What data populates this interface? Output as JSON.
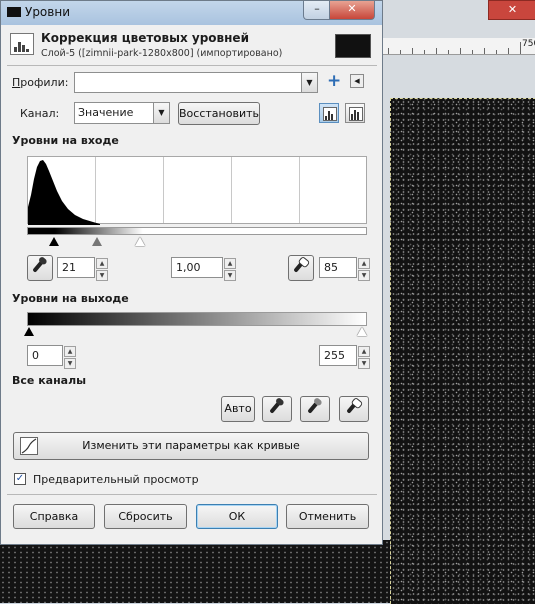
{
  "window": {
    "title": "Уровни",
    "close_glyph": "✕",
    "minimize_glyph": "–"
  },
  "header": {
    "title": "Коррекция цветовых уровней",
    "subtitle": "Слой-5 ([zimnii-park-1280x800] (импортировано)"
  },
  "profiles": {
    "label": "Профили:",
    "value": "",
    "add_icon": "plus-icon",
    "menu_icon": "triangle-left-icon"
  },
  "channel": {
    "label": "Канал:",
    "selected": "Значение",
    "reset_label": "Восстановить",
    "linear_mode": "active",
    "log_mode": "inactive"
  },
  "input_levels": {
    "heading": "Уровни на входе",
    "low": "21",
    "gamma": "1,00",
    "high": "85"
  },
  "output_levels": {
    "heading": "Уровни на выходе",
    "low": "0",
    "high": "255"
  },
  "all_channels": {
    "heading": "Все каналы",
    "auto_label": "Авто",
    "pickers": [
      "black-point-picker-icon",
      "gray-point-picker-icon",
      "white-point-picker-icon"
    ]
  },
  "curves_button": {
    "label": "Изменить эти параметры как кривые"
  },
  "preview": {
    "label": "Предварительный просмотр",
    "checked": true,
    "check_glyph": "✓"
  },
  "buttons": {
    "help": "Справка",
    "reset": "Сбросить",
    "ok": "ОК",
    "cancel": "Отменить"
  },
  "background": {
    "ruler_label": "750"
  },
  "colors": {
    "titlebar": "#b6cce3",
    "accent": "#3c7fb1",
    "histogram": "#000000",
    "image_dark": "#121212"
  }
}
